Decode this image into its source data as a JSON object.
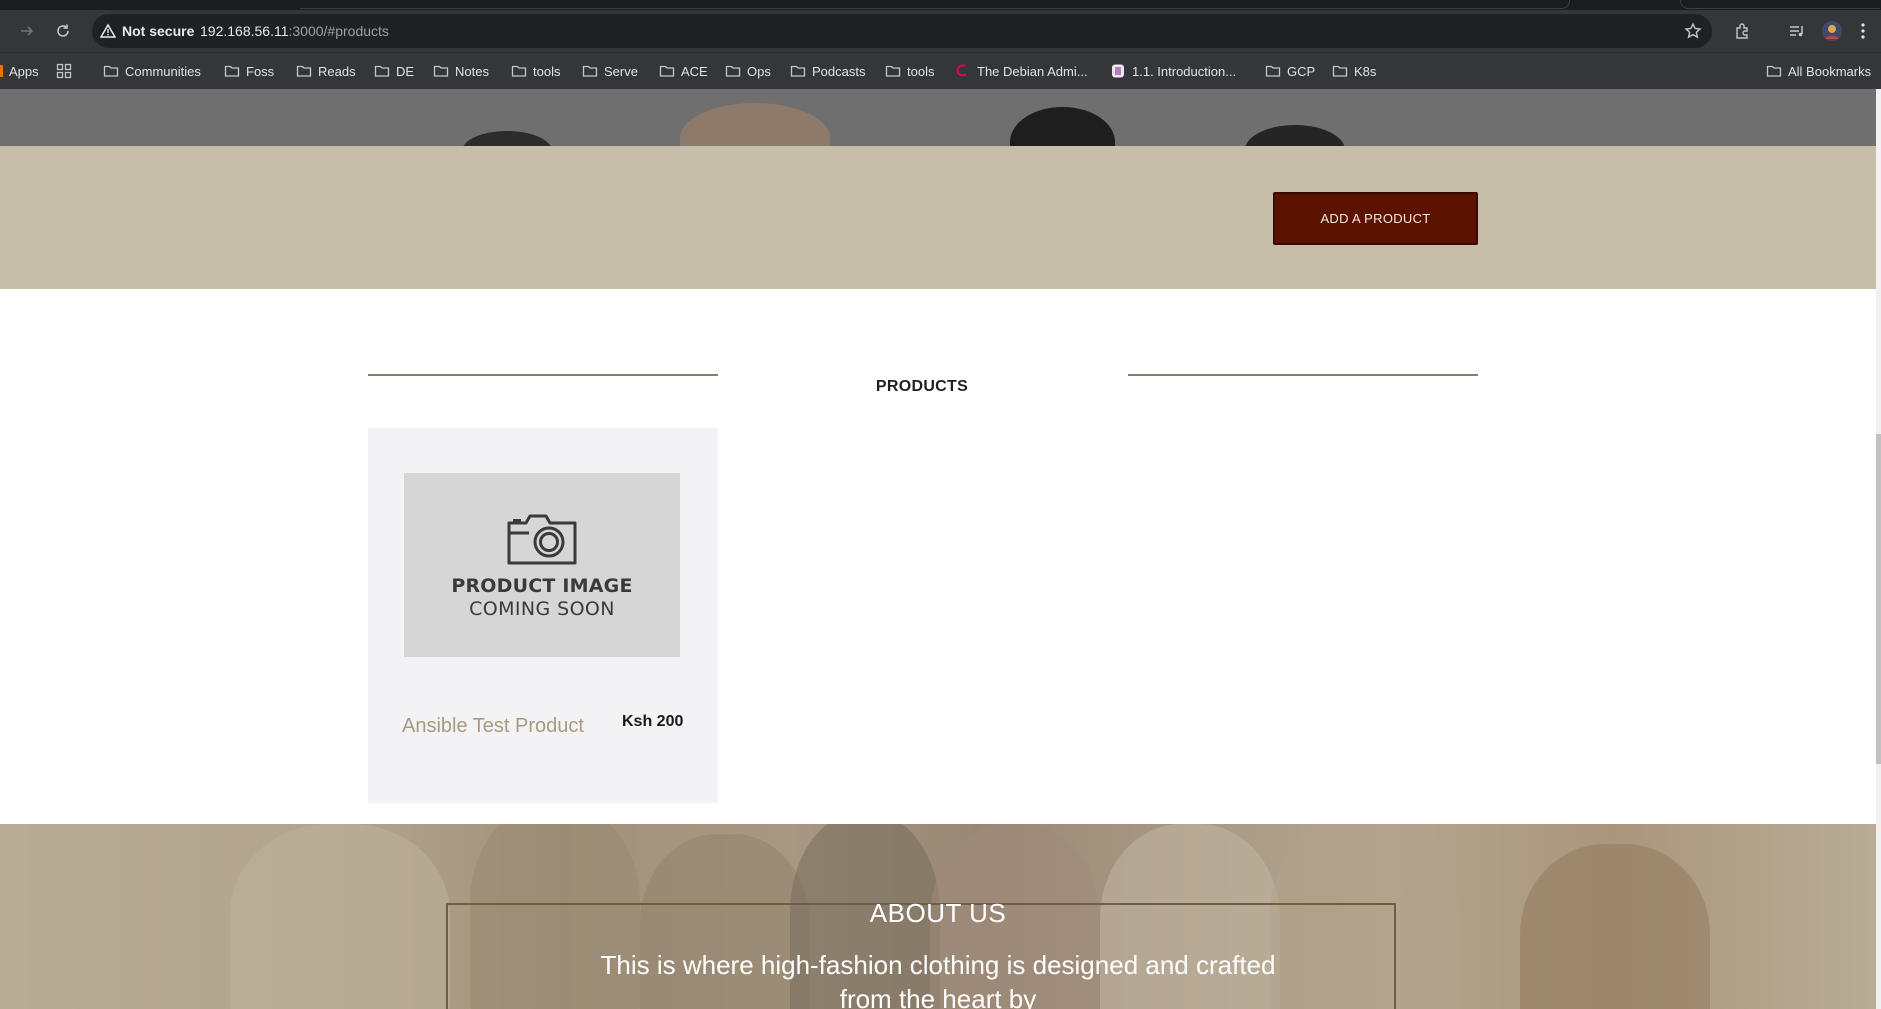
{
  "browser": {
    "security_label": "Not secure",
    "url_host": "192.168.56.11",
    "url_rest": ":3000/#products",
    "bookmarks": [
      {
        "label": "Apps",
        "icon": "apps-grid-icon"
      },
      {
        "label": "",
        "icon": "tab-groups-icon"
      },
      {
        "label": "Communities",
        "icon": "folder-icon"
      },
      {
        "label": "Foss",
        "icon": "folder-icon"
      },
      {
        "label": "Reads",
        "icon": "folder-icon"
      },
      {
        "label": "DE",
        "icon": "folder-icon"
      },
      {
        "label": "Notes",
        "icon": "folder-icon"
      },
      {
        "label": "tools",
        "icon": "folder-icon"
      },
      {
        "label": "Serve",
        "icon": "folder-icon"
      },
      {
        "label": "ACE",
        "icon": "folder-icon"
      },
      {
        "label": "Ops",
        "icon": "folder-icon"
      },
      {
        "label": "Podcasts",
        "icon": "folder-icon"
      },
      {
        "label": "tools",
        "icon": "folder-icon"
      },
      {
        "label": "The Debian Admi...",
        "icon": "debian-icon"
      },
      {
        "label": "1.1. Introduction...",
        "icon": "site-icon"
      },
      {
        "label": "GCP",
        "icon": "folder-icon"
      },
      {
        "label": "K8s",
        "icon": "folder-icon"
      }
    ],
    "all_bookmarks": "All Bookmarks"
  },
  "page": {
    "add_button": "ADD A PRODUCT",
    "products_heading": "PRODUCTS",
    "products": [
      {
        "image_line1": "PRODUCT IMAGE",
        "image_line2": "COMING SOON",
        "name": "Ansible Test Product",
        "price": "Ksh 200"
      }
    ],
    "about_heading": "ABOUT US",
    "about_text": "This is where high-fashion clothing is designed and crafted from the heart by"
  },
  "colors": {
    "accent_button": "#5b1300",
    "band": "#c6bea8",
    "product_name": "#a89a7e"
  }
}
